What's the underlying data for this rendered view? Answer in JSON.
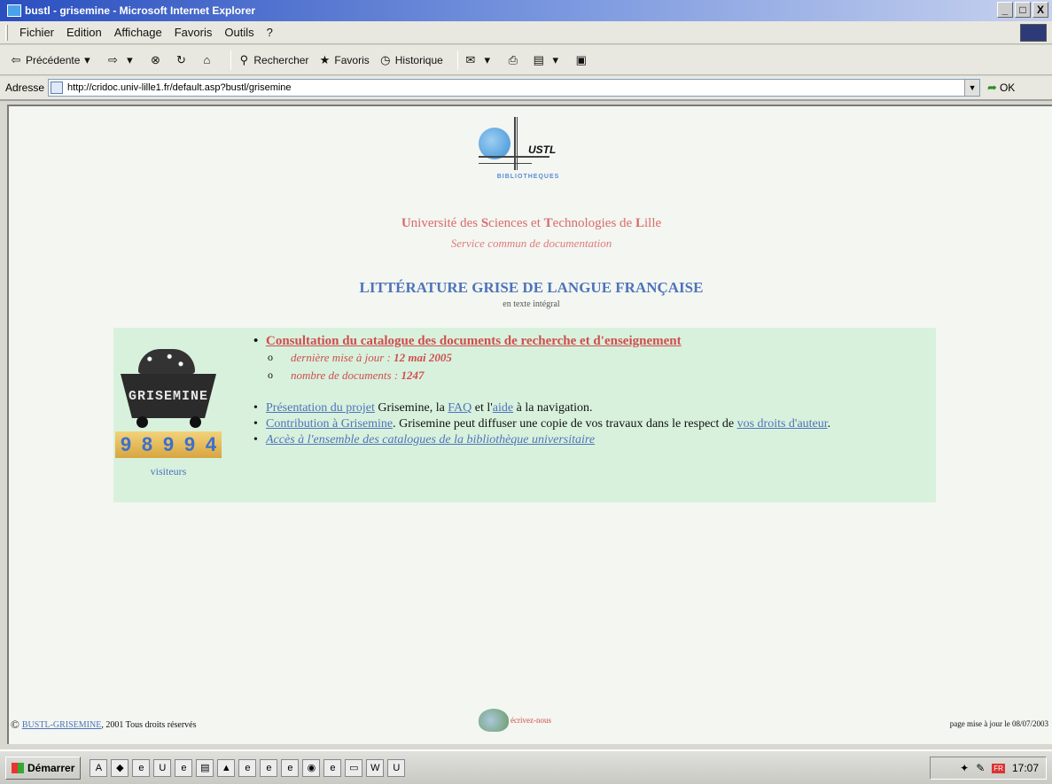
{
  "window": {
    "title": "bustl - grisemine - Microsoft Internet Explorer",
    "buttons": [
      "_",
      "□",
      "X"
    ]
  },
  "menubar": {
    "items": [
      "Fichier",
      "Edition",
      "Affichage",
      "Favoris",
      "Outils",
      "?"
    ]
  },
  "toolbar": {
    "back": "Précédente",
    "search": "Rechercher",
    "favorites": "Favoris",
    "history": "Historique"
  },
  "address": {
    "label": "Adresse",
    "url": "http://cridoc.univ-lille1.fr/default.asp?bustl/grisemine",
    "go": "OK"
  },
  "logo": {
    "name": "USTL",
    "subtitle": "BIBLIOTHEQUES"
  },
  "header": {
    "university_1": "U",
    "university_2": "niversité des ",
    "university_3": "S",
    "university_4": "ciences et ",
    "university_5": "T",
    "university_6": "echnologies de ",
    "university_7": "L",
    "university_8": "ille",
    "service": "Service commun de documentation",
    "title": "LITTÉRATURE GRISE DE LANGUE FRANÇAISE",
    "subtitle": "en texte intégral"
  },
  "panel": {
    "cart_label": "GRISEMINE",
    "counter_digits": [
      "9",
      "8",
      "9",
      "9",
      "4"
    ],
    "visitors_label": "visiteurs",
    "consultation": "Consultation du catalogue des documents de recherche et d'enseignement",
    "update_label": "dernière mise à jour : ",
    "update_value": "12 mai 2005",
    "count_label": "nombre de documents : ",
    "count_value": "1247",
    "presentation_link": "Présentation du projet",
    "presentation_text1": " Grisemine, la ",
    "faq_link": "FAQ",
    "presentation_text2": " et l'",
    "aide_link": "aide",
    "presentation_text3": " à la navigation.",
    "contribution_link": "Contribution à Grisemine",
    "contribution_text": ". Grisemine peut diffuser une copie de vos travaux dans le respect de ",
    "droits_link": "vos droits d'auteur",
    "contribution_end": ".",
    "catalogues_link": "Accès à l'ensemble des catalogues de la bibliothèque universitaire"
  },
  "footer": {
    "copyright_symbol": "©",
    "copyright_link": "BUSTL-GRISEMINE",
    "copyright_text": ", 2001 Tous droits réservés",
    "write_link": "écrivez-nous",
    "updated": "page mise à jour le 08/07/2003"
  },
  "taskbar": {
    "start": "Démarrer",
    "lang": "FR",
    "clock": "17:07"
  }
}
